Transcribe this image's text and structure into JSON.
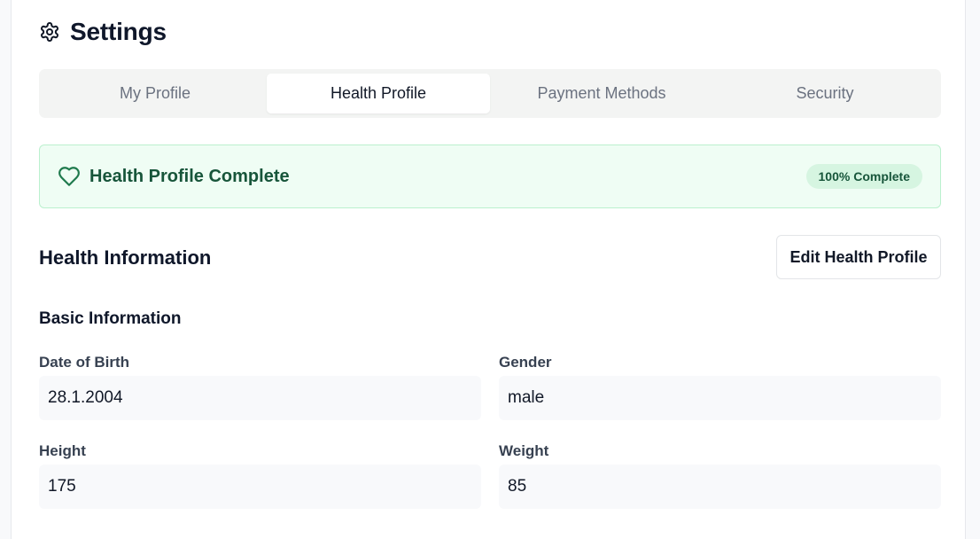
{
  "header": {
    "title": "Settings",
    "icon": "gear-icon"
  },
  "tabs": [
    {
      "label": "My Profile",
      "active": false
    },
    {
      "label": "Health Profile",
      "active": true
    },
    {
      "label": "Payment Methods",
      "active": false
    },
    {
      "label": "Security",
      "active": false
    }
  ],
  "banner": {
    "icon": "heart-icon",
    "title": "Health Profile Complete",
    "badge": "100% Complete",
    "completion_percent": 100,
    "accent_color": "#17553a",
    "background_color": "#effdf4"
  },
  "health": {
    "title": "Health Information",
    "edit_button": "Edit Health Profile",
    "basic": {
      "title": "Basic Information",
      "fields": [
        {
          "label": "Date of Birth",
          "value": "28.1.2004"
        },
        {
          "label": "Gender",
          "value": "male"
        },
        {
          "label": "Height",
          "value": "175"
        },
        {
          "label": "Weight",
          "value": "85"
        }
      ]
    }
  }
}
